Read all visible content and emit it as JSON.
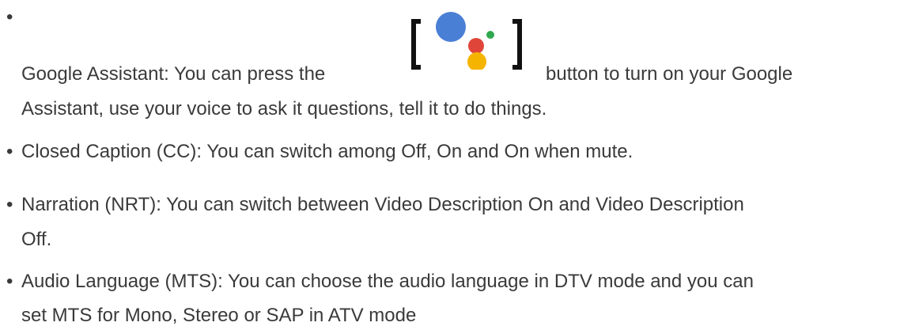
{
  "items": [
    {
      "name": "Google Assistant",
      "lines": [
        "Google Assistant: You can press the",
        "button to turn on your Google",
        "Assistant, use your voice to ask it questions, tell it to do things."
      ]
    },
    {
      "name": "Closed Caption",
      "lines": [
        "Closed Caption (CC): You can switch among Off, On and On when mute."
      ]
    },
    {
      "name": "Narration",
      "lines": [
        "Narration (NRT): You can switch between Video Description On and Video Description",
        "Off."
      ]
    },
    {
      "name": "Audio Language",
      "lines": [
        "Audio Language (MTS): You can choose the audio language in DTV mode and you can",
        "set MTS for Mono, Stereo or SAP in ATV mode"
      ]
    }
  ],
  "icons": {
    "assistant": "google-assistant-icon"
  },
  "colors": {
    "text": "#3a3a3a",
    "assistant_blue": "#4a7fd6",
    "assistant_red": "#e0453a",
    "assistant_yellow": "#f5b400",
    "assistant_green": "#2fa84f",
    "bracket": "#111111"
  }
}
